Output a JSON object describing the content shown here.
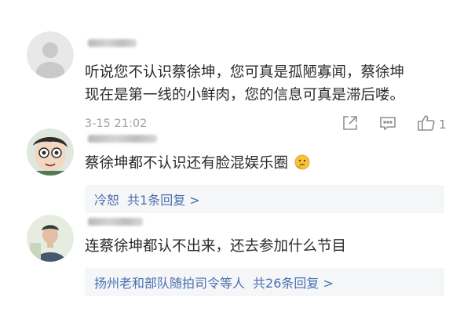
{
  "comments": [
    {
      "text_lines": [
        "听说您不认识蔡徐坤，您可真是孤陋寡闻，蔡徐坤",
        "现在是第一线的小鲜肉，您的信息可真是滞后喽。"
      ],
      "timestamp": "3-15 21:02",
      "like_count": "1"
    },
    {
      "text": "蔡徐坤都不认识还有脸混娱乐圈",
      "emoji": "thinking-face-emoji",
      "reply_author": "冷恕",
      "reply_count_label": "共1条回复 >"
    },
    {
      "text": "连蔡徐坤都认不出来，还去参加什么节目",
      "reply_author": "扬州老和部队随拍司令等人",
      "reply_count_label": "共26条回复 >"
    }
  ],
  "icons": {
    "share": "share-icon",
    "comment": "comment-icon",
    "like": "thumbs-up-icon"
  },
  "colors": {
    "text": "#2b2b2b",
    "meta": "#a3a3a3",
    "link": "#4a6fae",
    "reply_bg": "#f5f6f8"
  }
}
